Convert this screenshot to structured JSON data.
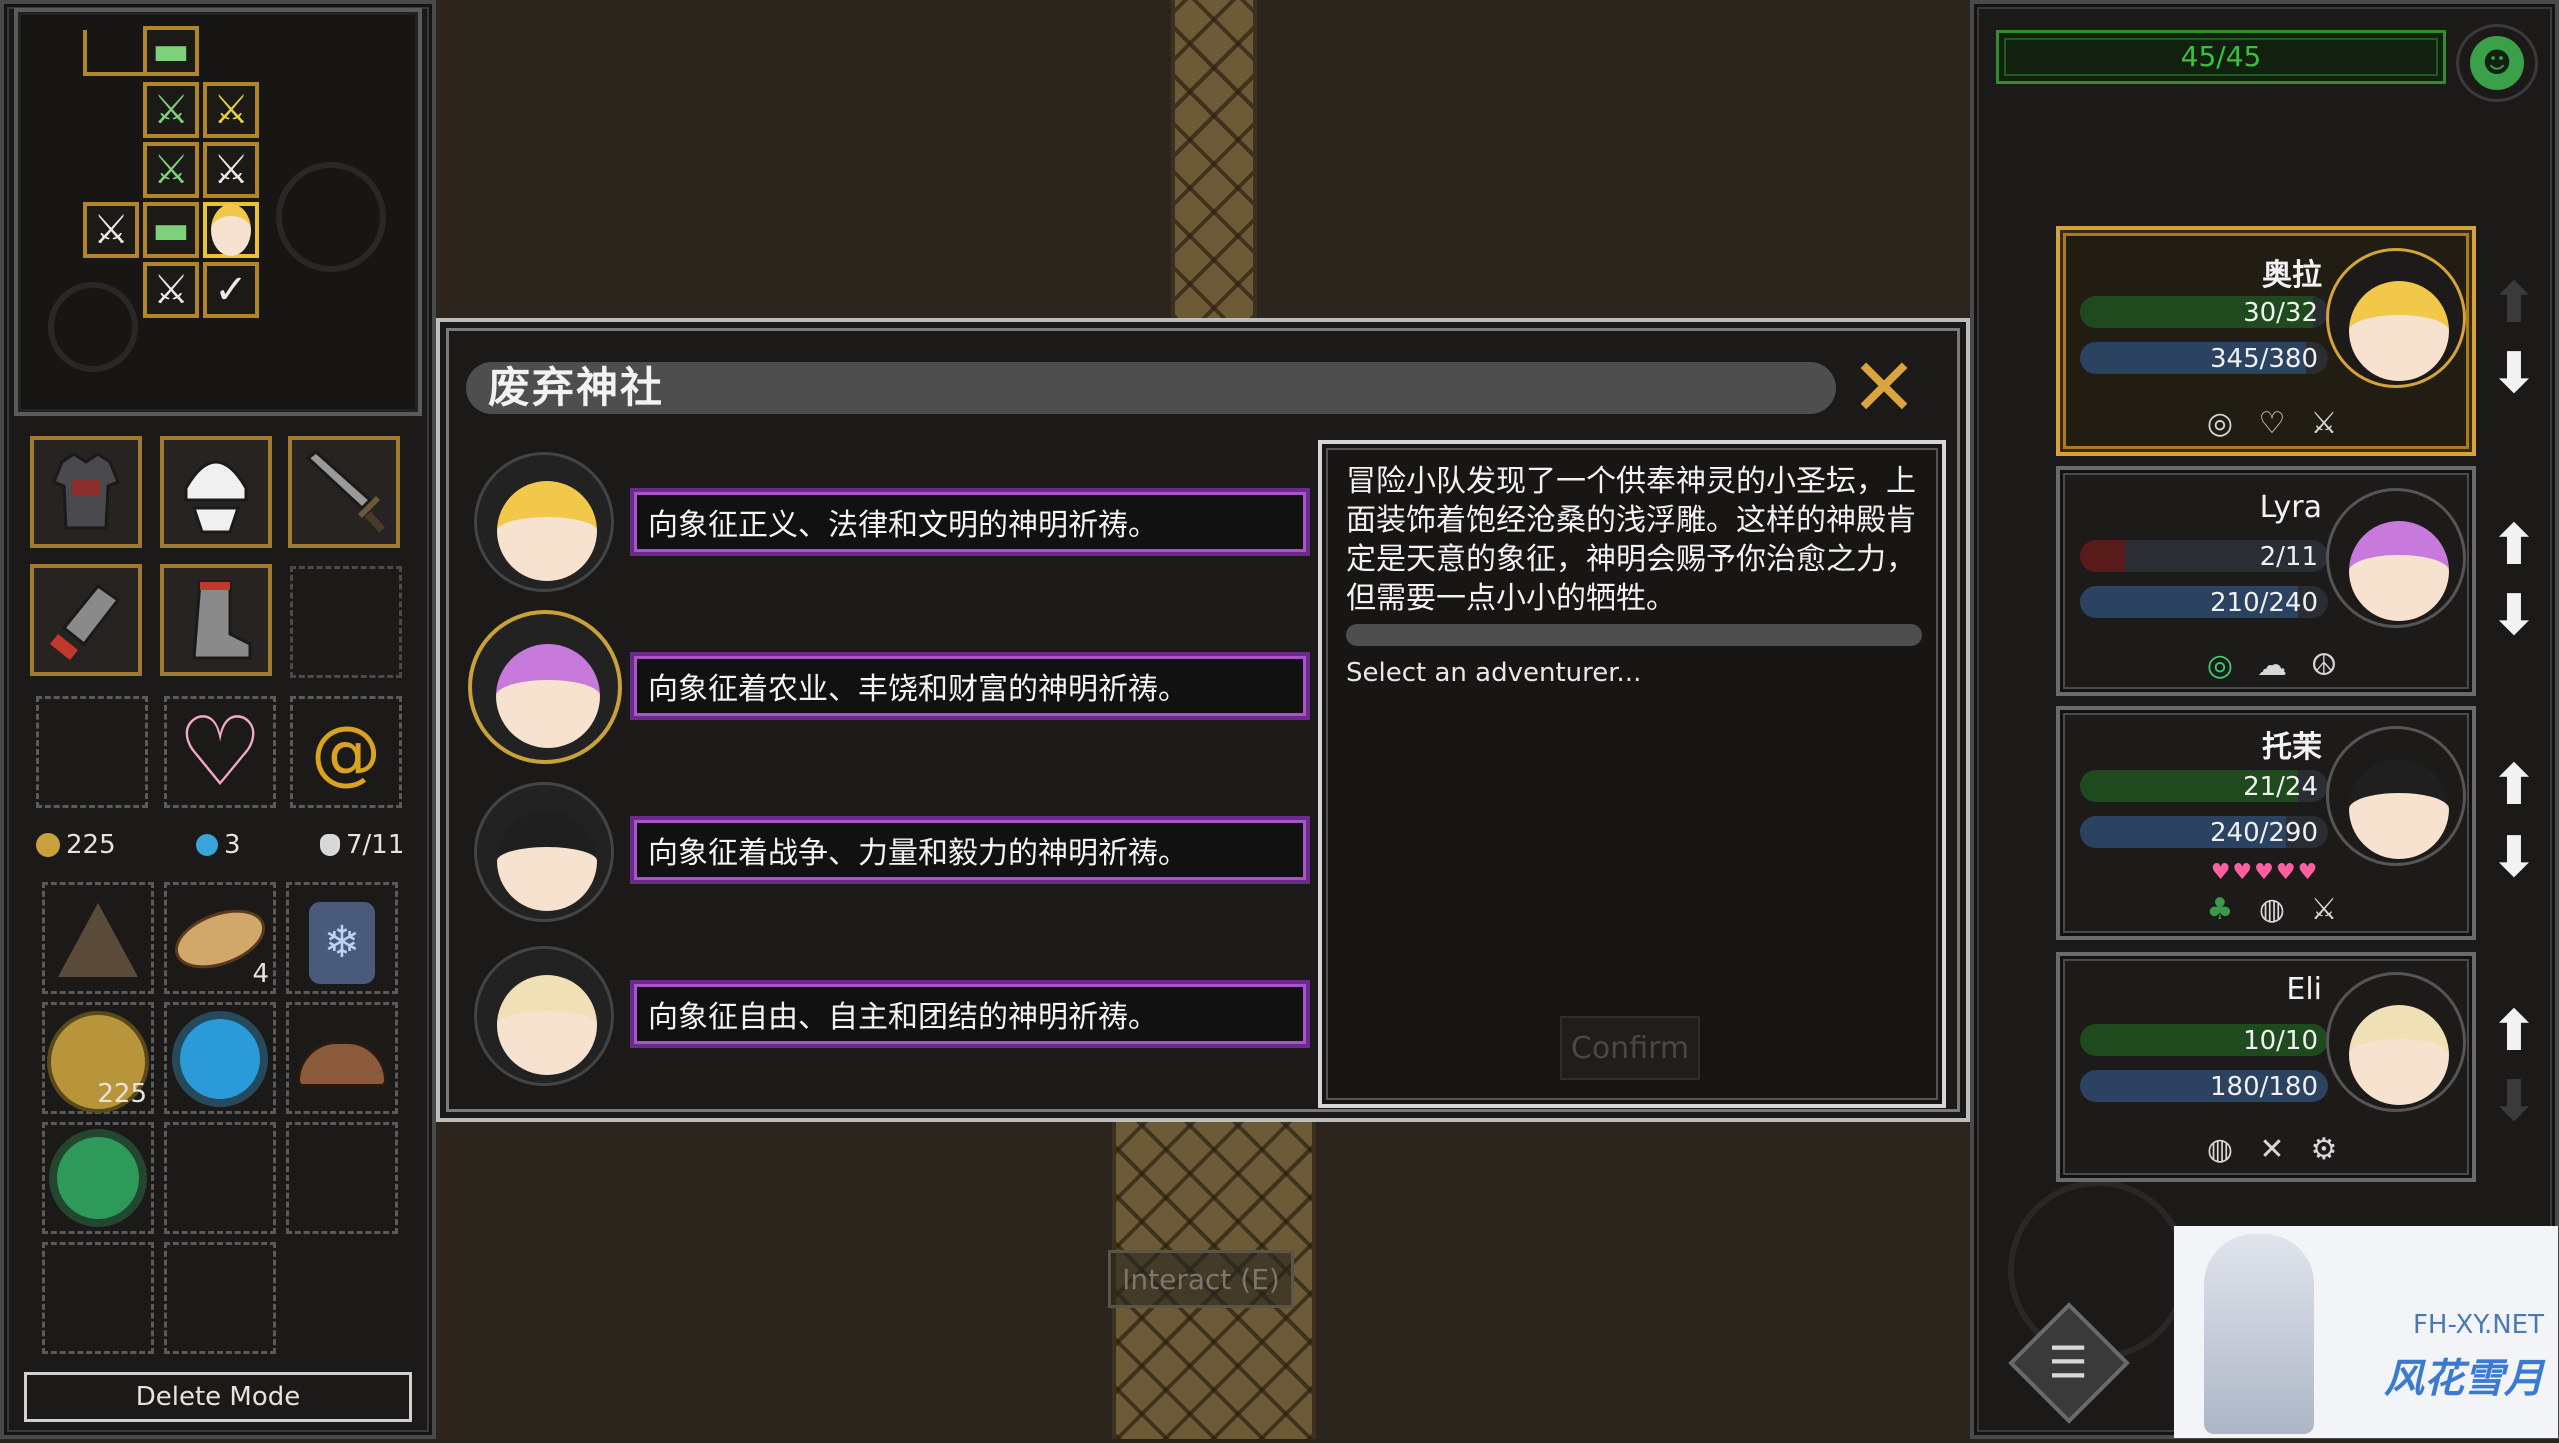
{
  "dialog": {
    "title": "废弃神社",
    "description": "冒险小队发现了一个供奉神灵的小圣坛，上面装饰着饱经沧桑的浅浮雕。这样的神殿肯定是天意的象征，神明会赐予你治愈之力，但需要一点小小的牺牲。",
    "prompt": "Select an adventurer...",
    "confirm_label": "Confirm",
    "options": [
      {
        "text": "向象征正义、法律和文明的神明祈祷。"
      },
      {
        "text": "向象征着农业、丰饶和财富的神明祈祷。"
      },
      {
        "text": "向象征着战争、力量和毅力的神明祈祷。"
      },
      {
        "text": "向象征自由、自主和团结的神明祈祷。"
      }
    ]
  },
  "interact_label": "Interact (E)",
  "resources": {
    "gold": "225",
    "gems": "3",
    "bag": "7/11"
  },
  "inventory": {
    "bread_count": "4",
    "coin_count": "225"
  },
  "delete_mode_label": "Delete Mode",
  "top_bar": {
    "counter": "45/45"
  },
  "party": [
    {
      "name": "奥拉",
      "hp": "30/32",
      "hp_frac": 0.94,
      "mp": "345/380",
      "mp_frac": 0.91,
      "selected": true,
      "hair": "#f2c84b",
      "icons": [
        "target-icon",
        "heart-outline-icon",
        "sword-icon"
      ]
    },
    {
      "name": "Lyra",
      "hp": "2/11",
      "hp_frac": 0.18,
      "mp": "210/240",
      "mp_frac": 0.88,
      "selected": false,
      "hair": "#c77adb",
      "icons": [
        "target-icon",
        "cloud-icon",
        "peace-icon"
      ]
    },
    {
      "name": "托茉",
      "hp": "21/24",
      "hp_frac": 0.88,
      "mp": "240/290",
      "mp_frac": 0.83,
      "selected": false,
      "hair": "#1f1f1f",
      "hearts": "♥♥♥♥♥",
      "icons": [
        "clover-icon",
        "bag-icon",
        "crossed-swords-icon"
      ]
    },
    {
      "name": "Eli",
      "hp": "10/10",
      "hp_frac": 1.0,
      "mp": "180/180",
      "mp_frac": 1.0,
      "selected": false,
      "hair": "#efe0b5",
      "icons": [
        "bag-icon",
        "cross-icon",
        "gear-icon"
      ]
    }
  ],
  "watermark": {
    "url": "FH-XY.NET",
    "name": "风花雪月"
  },
  "colors": {
    "accent_gold": "#d6a23a",
    "option_purple": "#a855c7",
    "close_x": "#d9a53c"
  }
}
